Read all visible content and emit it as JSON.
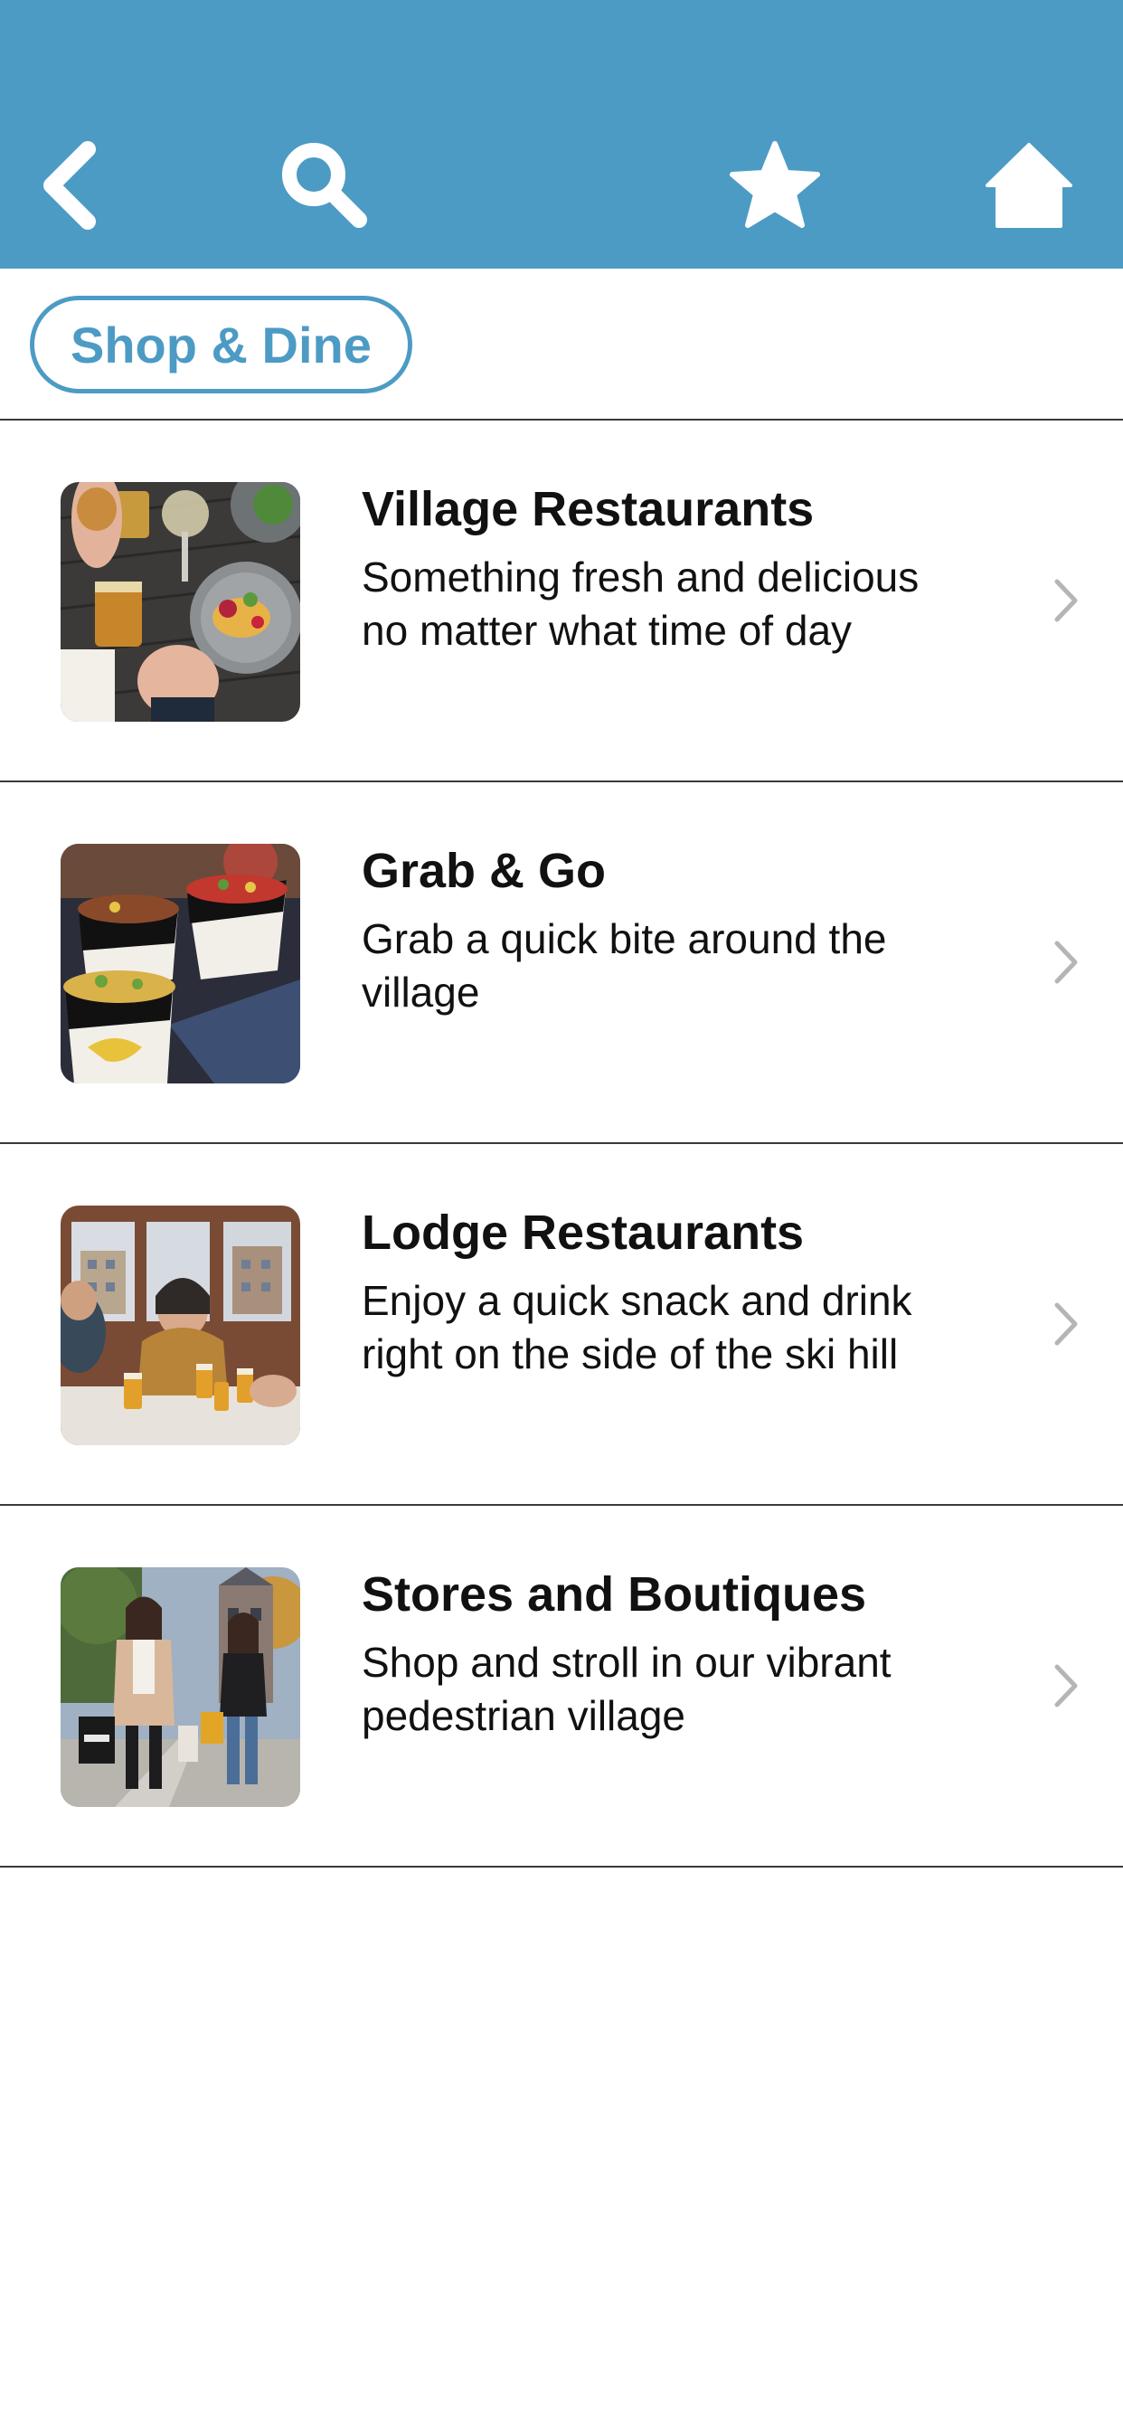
{
  "header": {
    "background_color": "#4c9bc4",
    "back_icon": "chevron-left-icon",
    "search_icon": "search-icon",
    "favorites_icon": "star-icon",
    "home_icon": "home-icon"
  },
  "category_chip": {
    "label": "Shop & Dine",
    "color": "#4c9bc4"
  },
  "items": [
    {
      "title": "Village Restaurants",
      "description": "Something fresh and delicious no matter what time of day",
      "image": "restaurant-table-photo"
    },
    {
      "title": "Grab & Go",
      "description": "Grab a quick bite around the village",
      "image": "food-bowls-photo"
    },
    {
      "title": "Lodge Restaurants",
      "description": "Enjoy a quick snack and drink right on the side of the ski hill",
      "image": "lodge-dining-photo"
    },
    {
      "title": "Stores and Boutiques",
      "description": "Shop and stroll in our vibrant pedestrian village",
      "image": "shoppers-village-photo"
    }
  ]
}
